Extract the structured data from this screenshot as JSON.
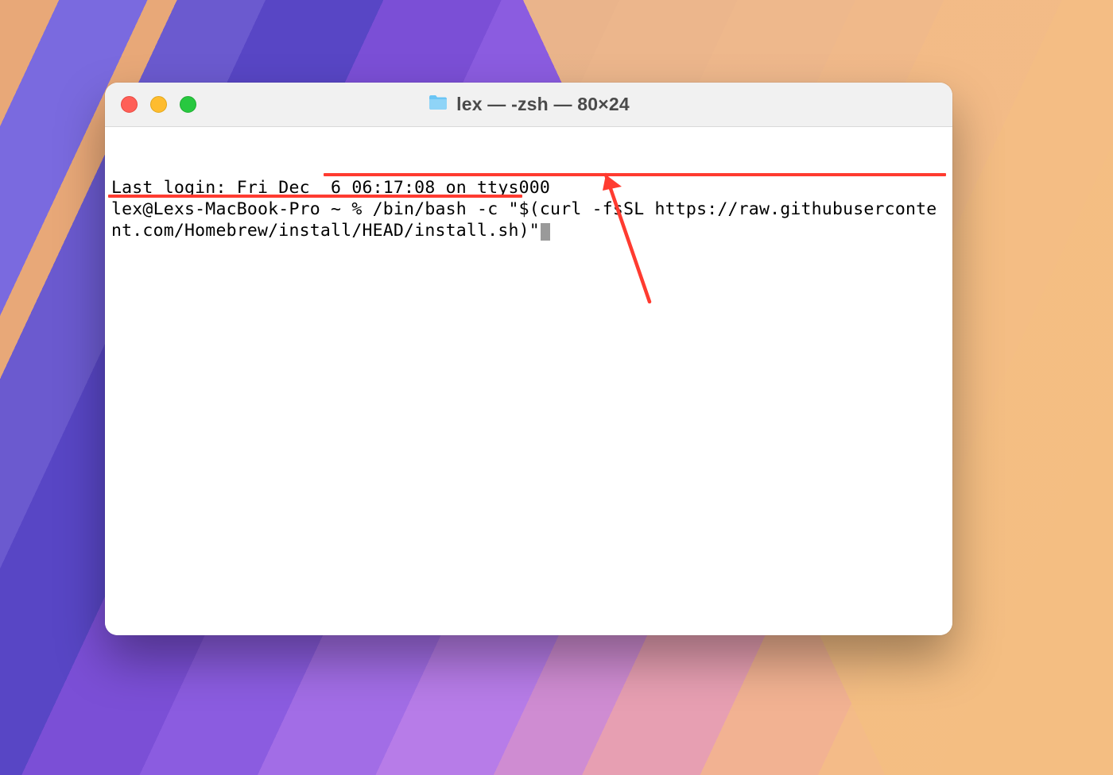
{
  "window": {
    "title": "lex — -zsh — 80×24"
  },
  "terminal": {
    "last_login": "Last login: Fri Dec  6 06:17:08 on ttys000",
    "prompt": "lex@Lexs-MacBook-Pro ~ % ",
    "command": "/bin/bash -c \"$(curl -fsSL https://raw.githubusercontent.com/Homebrew/install/HEAD/install.sh)\""
  },
  "annotations": {
    "arrow_color": "#ff3b30",
    "underline_color": "#ff3b30"
  }
}
